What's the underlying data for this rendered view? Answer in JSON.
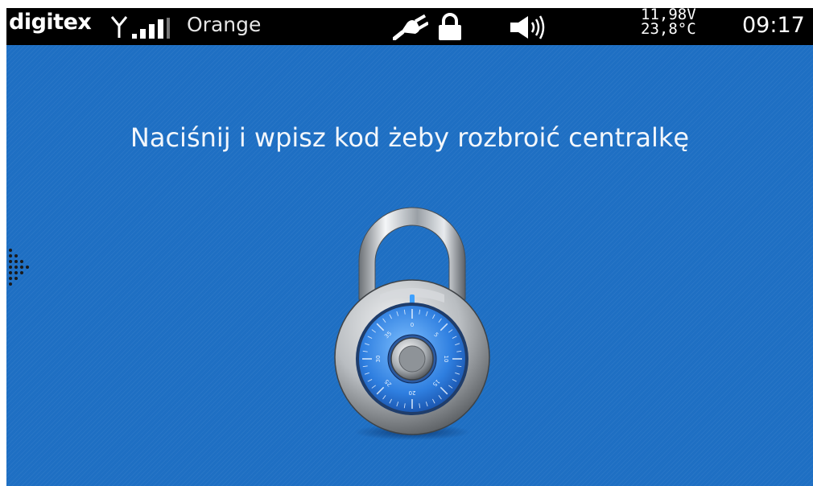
{
  "status_bar": {
    "brand": "digitex",
    "operator": "Orange",
    "voltage": "11,98V",
    "temperature": "23,8°C",
    "time": "09:17",
    "signal_bars": 4,
    "icons": [
      "antenna-icon",
      "signal-strength-icon",
      "power-plug-icon",
      "lock-icon",
      "speaker-icon"
    ]
  },
  "main": {
    "prompt": "Naciśnij i wpisz kod żeby rozbroić centralkę",
    "dial_numbers": [
      "0",
      "5",
      "10",
      "15",
      "20",
      "25",
      "30",
      "35"
    ]
  },
  "colors": {
    "background": "#1e6fc3",
    "status_bar": "#000000",
    "text": "#f2f6fb"
  }
}
